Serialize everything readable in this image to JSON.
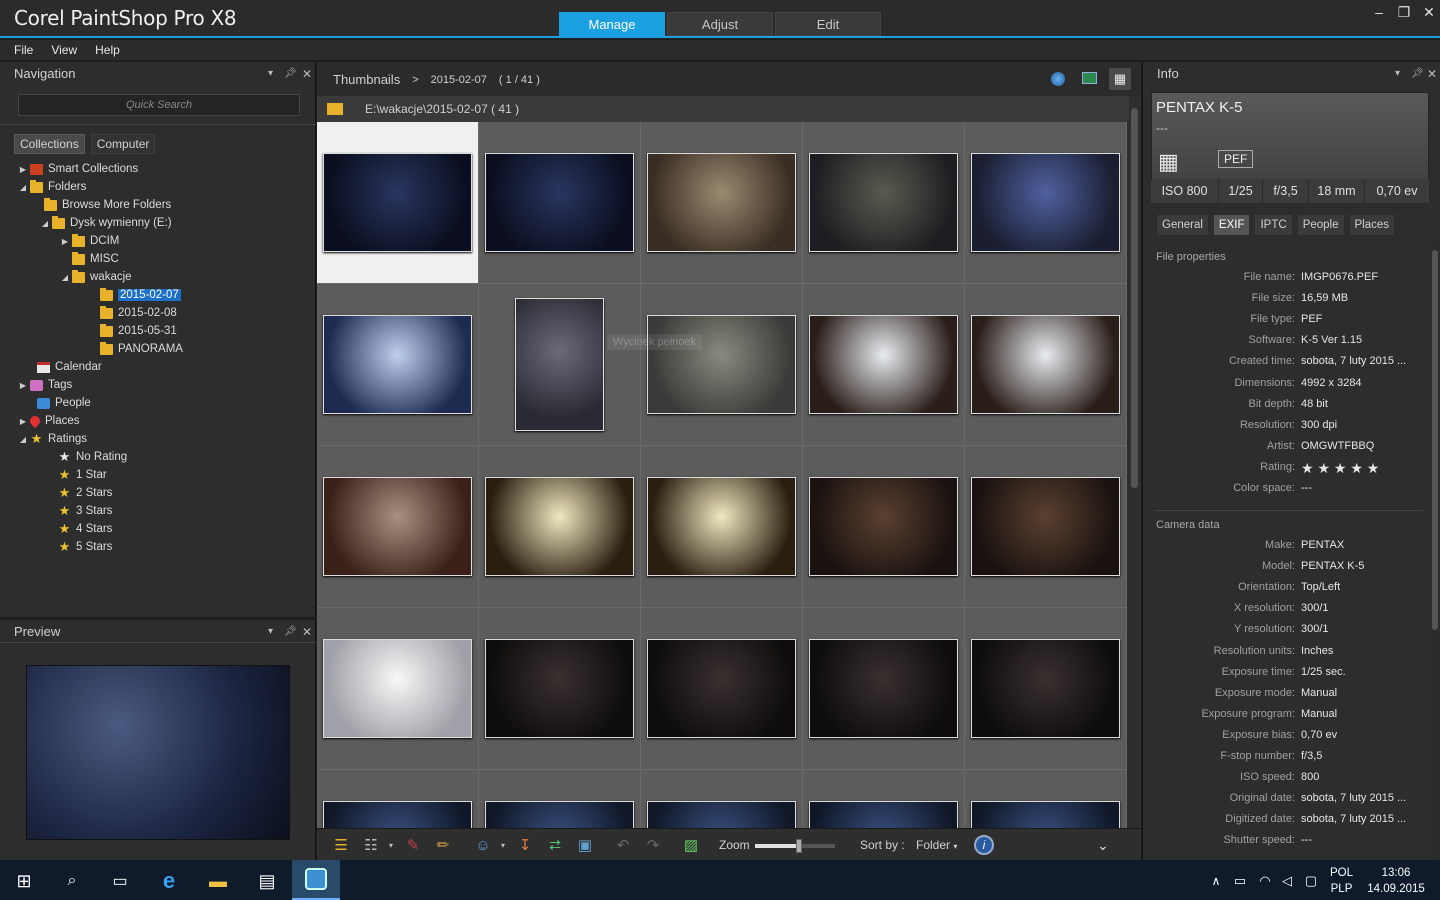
{
  "app": {
    "title": "Corel PaintShop Pro X8"
  },
  "tabs": [
    {
      "label": "Manage",
      "active": true
    },
    {
      "label": "Adjust"
    },
    {
      "label": "Edit"
    }
  ],
  "menu": [
    "File",
    "View",
    "Help"
  ],
  "nav": {
    "title": "Navigation",
    "quick_search_placeholder": "Quick Search",
    "subtabs": [
      "Collections",
      "Computer"
    ],
    "tree": [
      {
        "label": "Smart Collections",
        "icon": "smart-collections-icon"
      },
      {
        "label": "Folders",
        "icon": "folder-icon"
      },
      {
        "label": "Browse More Folders",
        "icon": "folder-icon"
      },
      {
        "label": "Dysk wymienny (E:)",
        "icon": "folder-icon"
      },
      {
        "label": "DCIM",
        "icon": "folder-icon"
      },
      {
        "label": "MISC",
        "icon": "folder-icon"
      },
      {
        "label": "wakacje",
        "icon": "folder-icon"
      },
      {
        "label": "2015-02-07",
        "icon": "folder-icon",
        "selected": true
      },
      {
        "label": "2015-02-08",
        "icon": "folder-icon"
      },
      {
        "label": "2015-05-31",
        "icon": "folder-icon"
      },
      {
        "label": "PANORAMA",
        "icon": "folder-icon"
      },
      {
        "label": "Calendar",
        "icon": "calendar-icon"
      },
      {
        "label": "Tags",
        "icon": "tag-icon"
      },
      {
        "label": "People",
        "icon": "people-icon"
      },
      {
        "label": "Places",
        "icon": "pin-icon"
      },
      {
        "label": "Ratings",
        "icon": "star-icon"
      },
      {
        "label": "No Rating",
        "icon": "star-outline-icon"
      },
      {
        "label": "1 Star",
        "icon": "star-icon"
      },
      {
        "label": "2 Stars",
        "icon": "star-icon"
      },
      {
        "label": "3 Stars",
        "icon": "star-icon"
      },
      {
        "label": "4 Stars",
        "icon": "star-icon"
      },
      {
        "label": "5 Stars",
        "icon": "star-icon"
      }
    ]
  },
  "preview": {
    "title": "Preview"
  },
  "browser": {
    "crumb_root": "Thumbnails",
    "crumb_sep": ">",
    "crumb_folder": "2015-02-07",
    "crumb_count": "( 1 / 41 )",
    "path": "E:\\wakacje\\2015-02-07 ( 41 )",
    "watermark": "Wycinek pełnoek"
  },
  "toolbar": {
    "zoom_label": "Zoom",
    "zoom_level": 0.55,
    "sort_label": "Sort by :",
    "sort_value": "Folder"
  },
  "info": {
    "title": "Info",
    "camera": "PENTAX K-5",
    "camera_sub": "---",
    "format": "PEF",
    "exif_summary": [
      "ISO 800",
      "1/25",
      "f/3,5",
      "18 mm",
      "0,70 ev"
    ],
    "tabs": [
      "General",
      "EXIF",
      "IPTC",
      "People",
      "Places"
    ],
    "active_tab": "EXIF",
    "file_section": "File properties",
    "file_props": [
      {
        "k": "File name:",
        "v": "IMGP0676.PEF"
      },
      {
        "k": "File size:",
        "v": "16,59 MB"
      },
      {
        "k": "File type:",
        "v": "PEF"
      },
      {
        "k": "Software:",
        "v": "K-5 Ver 1.15"
      },
      {
        "k": "Created time:",
        "v": "sobota, 7 luty 2015 ..."
      },
      {
        "k": "Dimensions:",
        "v": "4992 x 3284"
      },
      {
        "k": "Bit depth:",
        "v": "48 bit"
      },
      {
        "k": "Resolution:",
        "v": "300 dpi"
      },
      {
        "k": "Artist:",
        "v": "OMGWTFBBQ"
      },
      {
        "k": "Rating:",
        "v": "★ ★ ★ ★ ★"
      },
      {
        "k": "Color space:",
        "v": "---"
      }
    ],
    "camera_section": "Camera data",
    "camera_props": [
      {
        "k": "Make:",
        "v": "PENTAX"
      },
      {
        "k": "Model:",
        "v": "PENTAX K-5"
      },
      {
        "k": "Orientation:",
        "v": "Top/Left"
      },
      {
        "k": "X resolution:",
        "v": "300/1"
      },
      {
        "k": "Y resolution:",
        "v": "300/1"
      },
      {
        "k": "Resolution units:",
        "v": "Inches"
      },
      {
        "k": "Exposure time:",
        "v": "1/25 sec."
      },
      {
        "k": "Exposure mode:",
        "v": "Manual"
      },
      {
        "k": "Exposure program:",
        "v": "Manual"
      },
      {
        "k": "Exposure bias:",
        "v": "0,70 ev"
      },
      {
        "k": "F-stop number:",
        "v": "f/3,5"
      },
      {
        "k": "ISO speed:",
        "v": "800"
      },
      {
        "k": "Original date:",
        "v": "sobota, 7 luty 2015 ..."
      },
      {
        "k": "Digitized date:",
        "v": "sobota, 7 luty 2015 ..."
      },
      {
        "k": "Shutter speed:",
        "v": "---"
      }
    ]
  },
  "taskbar": {
    "lang1": "POL",
    "lang2": "PLP",
    "time": "13:06",
    "date": "14.09.2015"
  },
  "thumbnails": [
    {
      "name": "dark-blue-room",
      "c1": "#2a3560",
      "c2": "#0a0e1e"
    },
    {
      "name": "dark-blue-room-2",
      "c1": "#2a3560",
      "c2": "#0a0e1e"
    },
    {
      "name": "pillow",
      "c1": "#9a8a70",
      "c2": "#3a2e24"
    },
    {
      "name": "glass-vase",
      "c1": "#5a5a50",
      "c2": "#1e1e22"
    },
    {
      "name": "fireplace-grate",
      "c1": "#5060a0",
      "c2": "#1a1e30"
    },
    {
      "name": "lampshade",
      "c1": "#c0d0f0",
      "c2": "#1e2a50"
    },
    {
      "name": "fire-tools",
      "c1": "#6a6a78",
      "c2": "#2a2a34"
    },
    {
      "name": "candle-holder",
      "c1": "#8a8a80",
      "c2": "#3a3a38"
    },
    {
      "name": "statue",
      "c1": "#e8ecf0",
      "c2": "#2a1e1a"
    },
    {
      "name": "statue-2",
      "c1": "#e8ecf0",
      "c2": "#2a1e1a"
    },
    {
      "name": "marble-table",
      "c1": "#a89080",
      "c2": "#3a2018"
    },
    {
      "name": "lamp",
      "c1": "#f0e8c0",
      "c2": "#2a1e10"
    },
    {
      "name": "lamp-2",
      "c1": "#f0e8c0",
      "c2": "#2a1e10"
    },
    {
      "name": "soldier-figures",
      "c1": "#5a4030",
      "c2": "#1a1210"
    },
    {
      "name": "soldier-figure",
      "c1": "#5a4030",
      "c2": "#1a1210"
    },
    {
      "name": "wall-lantern",
      "c1": "#f8f8f8",
      "c2": "#a0a0a8"
    },
    {
      "name": "fireplace",
      "c1": "#3a3030",
      "c2": "#0e0c0c"
    },
    {
      "name": "fireplace-2",
      "c1": "#3a3030",
      "c2": "#0e0c0c"
    },
    {
      "name": "fireplace-3",
      "c1": "#3a3030",
      "c2": "#0e0c0c"
    },
    {
      "name": "fireplace-4",
      "c1": "#3a3030",
      "c2": "#0e0c0c"
    },
    {
      "name": "blue-1",
      "c1": "#3a5080",
      "c2": "#101828"
    },
    {
      "name": "blue-2",
      "c1": "#3a5080",
      "c2": "#101828"
    },
    {
      "name": "blue-3",
      "c1": "#3a5080",
      "c2": "#101828"
    },
    {
      "name": "blue-4",
      "c1": "#3a5080",
      "c2": "#101828"
    },
    {
      "name": "blue-5",
      "c1": "#3a5080",
      "c2": "#101828"
    }
  ]
}
